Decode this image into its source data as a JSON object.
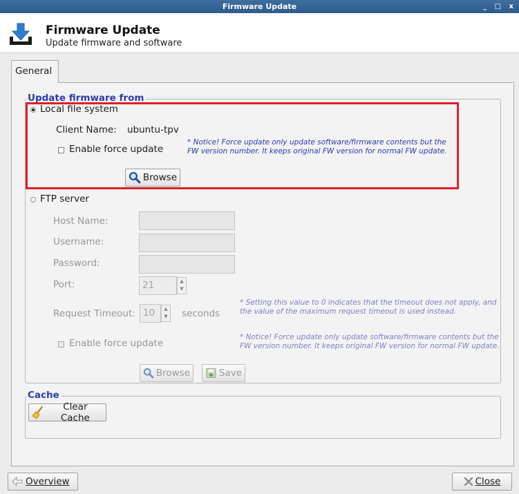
{
  "window": {
    "title": "Firmware Update",
    "controls": "_ □ x"
  },
  "header": {
    "title": "Firmware Update",
    "subtitle": "Update firmware and software",
    "icon": "download-icon"
  },
  "tabs": [
    {
      "label": "General",
      "active": true
    }
  ],
  "update_group": {
    "title": "Update firmware from",
    "local": {
      "label": "Local file system",
      "selected": true,
      "client_label": "Client Name:",
      "client_value": "ubuntu-tpv",
      "force_update_label": "Enable force update",
      "force_update_checked": false,
      "notice": "* Notice! Force update only update software/firmware contents but the FW version number. It keeps original FW version for normal FW update.",
      "browse_label": "Browse"
    },
    "ftp": {
      "label": "FTP server",
      "selected": false,
      "host_label": "Host Name:",
      "host_value": "",
      "username_label": "Username:",
      "username_value": "",
      "password_label": "Password:",
      "password_value": "",
      "port_label": "Port:",
      "port_value": "21",
      "timeout_label": "Request Timeout:",
      "timeout_value": "10",
      "timeout_unit": "seconds",
      "timeout_notice": "* Setting this value to 0 indicates that the timeout does not apply, and the value of the maximum request timeout is used instead.",
      "force_update_label": "Enable force update",
      "force_update_checked": false,
      "force_notice": "* Notice! Force update only update software/firmware contents but the FW version number. It keeps original FW version for normal FW update.",
      "browse_label": "Browse",
      "save_label": "Save"
    }
  },
  "cache_group": {
    "title": "Cache",
    "clear_label": "Clear Cache"
  },
  "footer": {
    "overview_label": "Overview",
    "close_label": "Close"
  },
  "colors": {
    "accent": "#2a3cb0",
    "highlight": "#e01d28",
    "titlebar": "#2d5c8c"
  }
}
